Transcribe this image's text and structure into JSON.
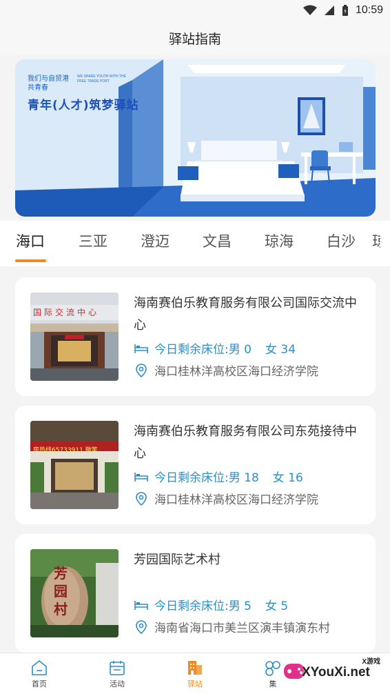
{
  "status_bar": {
    "time": "10:59"
  },
  "header": {
    "title": "驿站指南"
  },
  "banner": {
    "line1": "我们与自贸港 共青春",
    "line2": "WE SHARE YOUTH WITH THE FREE TRADE PORT",
    "title": "青年(人才)筑梦驿站"
  },
  "tabs": [
    {
      "label": "海口",
      "active": true
    },
    {
      "label": "三亚"
    },
    {
      "label": "澄迈"
    },
    {
      "label": "文昌"
    },
    {
      "label": "琼海"
    },
    {
      "label": "白沙"
    },
    {
      "label": "琼"
    }
  ],
  "cards": [
    {
      "name": "海南赛伯乐教育服务有限公司国际交流中心",
      "beds_label": "今日剩余床位:",
      "male": "男 0",
      "female": "女 34",
      "address": "海口桂林洋高校区海口经济学院",
      "photo_text": "国际交流中心"
    },
    {
      "name": "海南赛伯乐教育服务有限公司东苑接待中心",
      "beds_label": "今日剩余床位:",
      "male": "男 18",
      "female": "女 16",
      "address": "海口桂林洋高校区海口经济学院",
      "photo_text": "房热线65733911 微笑"
    },
    {
      "name": "芳园国际艺术村",
      "beds_label": "今日剩余床位:",
      "male": "男 5",
      "female": "女 5",
      "address": "海南省海口市美兰区演丰镇演东村",
      "photo_text": "芳园村"
    }
  ],
  "bottom_nav": {
    "items": [
      {
        "label": "首页",
        "icon": "home-icon"
      },
      {
        "label": "活动",
        "icon": "calendar-icon"
      },
      {
        "label": "驿站",
        "icon": "building-icon",
        "active": true
      },
      {
        "label": "集",
        "icon": "gamepad-icon"
      }
    ]
  },
  "watermark": {
    "top": "X游戏",
    "main": "XYouXi.net"
  },
  "colors": {
    "accent": "#f08a22",
    "info": "#2b8fc7",
    "banner_blue": "#1c4fb8"
  }
}
